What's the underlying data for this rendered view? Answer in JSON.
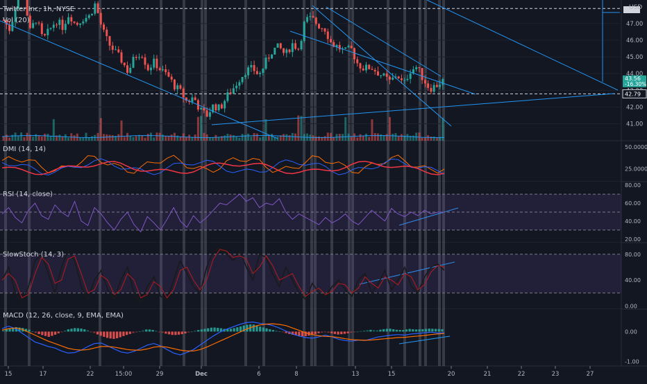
{
  "header": {
    "symbol_line": "Twitter Inc, 1h, NYSE",
    "volume_label": "Vol (20)",
    "currency": "USD"
  },
  "price_badges": {
    "current": "43.56",
    "change": "-16.30%",
    "level": "42.79"
  },
  "colors": {
    "background": "#131722",
    "up": "#26a69a",
    "down": "#ef5350",
    "trendline": "#2196f3",
    "session_band": "#787b86",
    "plus_di": "#2962ff",
    "minus_di": "#f23645",
    "adx": "#ff6d00",
    "rsi": "#7e57c2",
    "stoch_k": "#b71c1c",
    "macd": "#2962ff",
    "signal": "#ff6d00"
  },
  "chart_data": [
    {
      "type": "candlestick",
      "title": "Twitter Inc, 1h, NYSE",
      "ylabel": "USD",
      "ylim": [
        40.4,
        48.2
      ],
      "y_ticks": [
        "47.00",
        "46.00",
        "45.00",
        "44.00",
        "43.00",
        "42.00",
        "41.00"
      ],
      "x_ticks": [
        "15",
        "17",
        "22",
        "15:00",
        "29",
        "Dec",
        "6",
        "8",
        "13",
        "15",
        "20",
        "21",
        "22",
        "23",
        "27"
      ],
      "dashed_levels": [
        47.9,
        42.79
      ],
      "close_path": [
        47.2,
        46.6,
        48.4,
        49.1,
        46.5,
        47.3,
        46.0,
        46.6,
        47.2,
        46.8,
        47.6,
        46.9,
        47.3,
        47.4,
        48.2,
        46.7,
        45.8,
        45.3,
        44.8,
        44.1,
        45.0,
        45.3,
        44.3,
        44.7,
        44.2,
        43.9,
        43.3,
        42.9,
        42.3,
        42.6,
        41.8,
        41.5,
        42.1,
        41.9,
        42.6,
        43.1,
        43.7,
        44.2,
        44.3,
        43.9,
        44.7,
        45.4,
        45.6,
        45.1,
        45.8,
        45.5,
        47.2,
        47.3,
        46.9,
        46.7,
        45.8,
        45.6,
        45.3,
        45.5,
        44.6,
        44.3,
        44.4,
        44.1,
        43.8,
        43.5,
        44.0,
        43.3,
        44.2,
        44.4,
        43.7,
        43.1,
        43.3,
        43.56
      ],
      "volume_ylim": [
        0,
        1
      ]
    },
    {
      "type": "line",
      "title": "DMI (14, 14)",
      "y_ticks": [
        "50.0000",
        "25.0000"
      ],
      "ylim": [
        10,
        55
      ]
    },
    {
      "type": "line",
      "title": "RSI (14, close)",
      "y_ticks": [
        "80.00",
        "60.00",
        "40.00",
        "20.00"
      ],
      "ylim": [
        16,
        84
      ],
      "bands": [
        30,
        70
      ],
      "midline": 50,
      "rsi": [
        48,
        55,
        44,
        38,
        52,
        60,
        46,
        42,
        58,
        50,
        45,
        62,
        40,
        35,
        55,
        48,
        38,
        30,
        42,
        50,
        36,
        28,
        45,
        38,
        30,
        42,
        55,
        40,
        33,
        46,
        38,
        44,
        52,
        60,
        58,
        64,
        70,
        62,
        66,
        55,
        60,
        58,
        65,
        50,
        42,
        48,
        44,
        40,
        36,
        44,
        38,
        42,
        48,
        40,
        36,
        44,
        52,
        46,
        40,
        54,
        48,
        45,
        50,
        46,
        52,
        48,
        50,
        50
      ]
    },
    {
      "type": "line",
      "title": "SlowStoch (14, 3)",
      "y_ticks": [
        "80.00",
        "40.00",
        "0.00"
      ],
      "ylim": [
        -5,
        98
      ],
      "bands": [
        20,
        80
      ],
      "k": [
        40,
        60,
        20,
        5,
        30,
        70,
        80,
        50,
        20,
        60,
        85,
        70,
        30,
        10,
        40,
        55,
        25,
        10,
        40,
        60,
        20,
        5,
        30,
        45,
        15,
        10,
        40,
        70,
        50,
        30,
        20,
        60,
        85,
        90,
        80,
        70,
        85,
        60,
        40,
        80,
        75,
        50,
        30,
        60,
        40,
        20,
        10,
        35,
        20,
        15,
        30,
        40,
        25,
        15,
        40,
        50,
        20,
        35,
        55,
        25,
        40,
        60,
        30,
        20,
        45,
        60,
        65,
        55
      ]
    },
    {
      "type": "bar",
      "title": "MACD (12, 26, close, 9, EMA, EMA)",
      "y_ticks": [
        "0.00",
        "-1.00"
      ],
      "ylim": [
        -1.15,
        0.75
      ],
      "histogram": [
        0.05,
        0.1,
        0.15,
        0.12,
        0.06,
        -0.05,
        -0.12,
        -0.18,
        -0.1,
        0.0,
        0.08,
        0.12,
        0.1,
        0.04,
        -0.06,
        -0.15,
        -0.22,
        -0.25,
        -0.18,
        -0.1,
        -0.04,
        0.02,
        0.08,
        0.05,
        -0.02,
        -0.08,
        -0.12,
        -0.1,
        -0.05,
        0.02,
        0.06,
        0.1,
        0.14,
        0.12,
        0.08,
        0.1,
        0.16,
        0.22,
        0.25,
        0.18,
        0.12,
        0.06,
        0.02,
        -0.04,
        -0.1,
        -0.14,
        -0.16,
        -0.12,
        -0.06,
        -0.02,
        -0.05,
        -0.1,
        -0.08,
        -0.04,
        0.0,
        0.03,
        0.06,
        0.04,
        0.08,
        0.1,
        0.06,
        0.05,
        0.09,
        0.07,
        0.08,
        0.1,
        0.09,
        0.08
      ],
      "macd": [
        0.1,
        0.18,
        0.1,
        -0.05,
        -0.2,
        -0.35,
        -0.42,
        -0.5,
        -0.55,
        -0.65,
        -0.72,
        -0.7,
        -0.62,
        -0.5,
        -0.4,
        -0.38,
        -0.48,
        -0.58,
        -0.68,
        -0.72,
        -0.66,
        -0.56,
        -0.45,
        -0.4,
        -0.48,
        -0.6,
        -0.72,
        -0.78,
        -0.7,
        -0.6,
        -0.45,
        -0.3,
        -0.15,
        -0.02,
        0.08,
        0.16,
        0.24,
        0.3,
        0.32,
        0.28,
        0.25,
        0.2,
        0.12,
        0.02,
        -0.08,
        -0.15,
        -0.2,
        -0.22,
        -0.18,
        -0.12,
        -0.18,
        -0.26,
        -0.3,
        -0.32,
        -0.28,
        -0.3,
        -0.24,
        -0.18,
        -0.15,
        -0.12,
        -0.1,
        -0.12,
        -0.08,
        -0.06,
        -0.04,
        -0.02,
        -0.05,
        -0.04
      ],
      "signal": [
        0.05,
        0.1,
        0.12,
        0.08,
        -0.02,
        -0.12,
        -0.22,
        -0.32,
        -0.4,
        -0.48,
        -0.56,
        -0.6,
        -0.62,
        -0.6,
        -0.55,
        -0.5,
        -0.5,
        -0.52,
        -0.56,
        -0.6,
        -0.62,
        -0.62,
        -0.58,
        -0.52,
        -0.5,
        -0.52,
        -0.57,
        -0.62,
        -0.65,
        -0.65,
        -0.6,
        -0.52,
        -0.42,
        -0.32,
        -0.22,
        -0.12,
        -0.02,
        0.08,
        0.16,
        0.22,
        0.25,
        0.26,
        0.24,
        0.2,
        0.12,
        0.04,
        -0.04,
        -0.1,
        -0.14,
        -0.16,
        -0.17,
        -0.2,
        -0.24,
        -0.27,
        -0.28,
        -0.29,
        -0.28,
        -0.26,
        -0.24,
        -0.22,
        -0.2,
        -0.19,
        -0.17,
        -0.15,
        -0.13,
        -0.1,
        -0.08,
        -0.06
      ]
    }
  ]
}
